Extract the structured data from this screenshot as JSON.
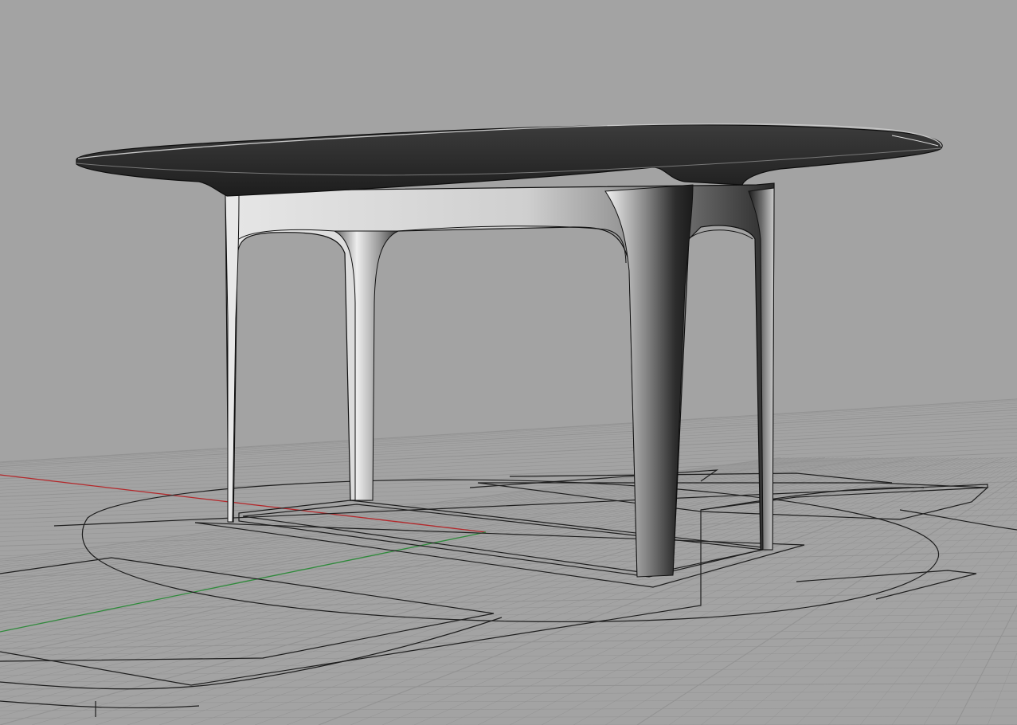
{
  "viewport": {
    "display_mode": "shaded",
    "background_color": "#a3a3a3",
    "grid_line_color": "#939393",
    "x_axis_color": "#b4272a",
    "y_axis_color": "#2f8a3b",
    "curve_color": "#1e1e1e",
    "model": "table",
    "model_shading": {
      "top_dark": "#2b2b2b",
      "apron_light": "#d8d8d8",
      "leg_mid": "#9a9a9a"
    }
  }
}
